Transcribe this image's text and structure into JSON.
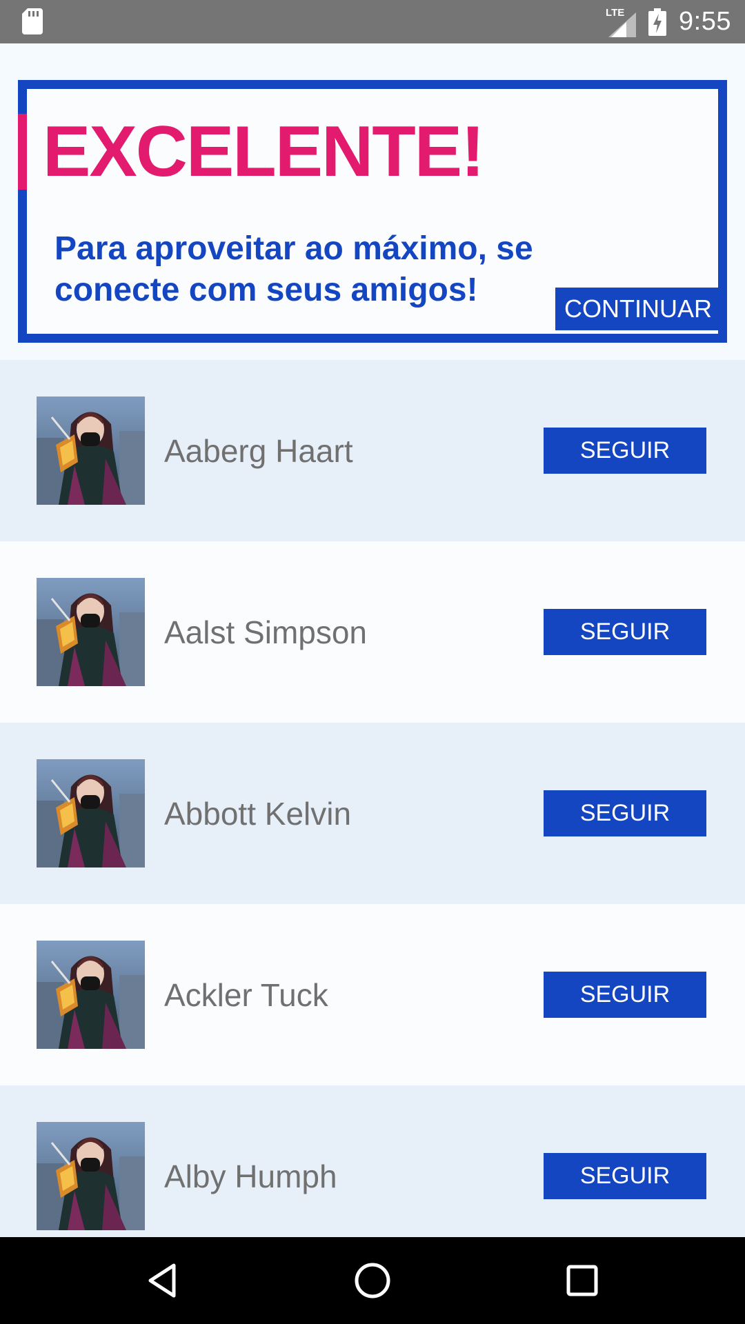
{
  "status_bar": {
    "time": "9:55",
    "network_label": "LTE",
    "icons": [
      "sd-card-icon",
      "signal-icon",
      "battery-charging-icon"
    ]
  },
  "banner": {
    "title": "EXCELENTE!",
    "subtitle": "Para aproveitar ao máximo, se conecte com seus amigos!",
    "continue_label": "CONTINUAR",
    "colors": {
      "title": "#e21b6e",
      "accent": "#1546c2"
    }
  },
  "friends": [
    {
      "name": "Aaberg Haart",
      "follow_label": "SEGUIR"
    },
    {
      "name": "Aalst Simpson",
      "follow_label": "SEGUIR"
    },
    {
      "name": "Abbott Kelvin",
      "follow_label": "SEGUIR"
    },
    {
      "name": "Ackler Tuck",
      "follow_label": "SEGUIR"
    },
    {
      "name": "Alby Humph",
      "follow_label": "SEGUIR"
    }
  ],
  "nav_bar": {
    "icons": [
      "back-icon",
      "home-icon",
      "recents-icon"
    ]
  }
}
